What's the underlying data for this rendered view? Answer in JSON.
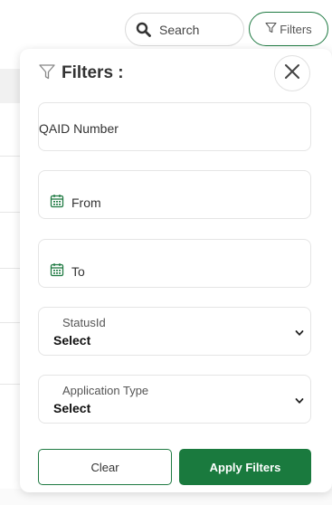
{
  "toolbar": {
    "search_label": "Search",
    "filters_label": "Filters"
  },
  "panel": {
    "title": "Filters :",
    "qaid_placeholder": "QAID Number",
    "from_label": "From",
    "to_label": "To",
    "status": {
      "label": "StatusId",
      "value": "Select"
    },
    "app_type": {
      "label": "Application Type",
      "value": "Select"
    },
    "clear_label": "Clear",
    "apply_label": "Apply Filters"
  },
  "colors": {
    "accent": "#1a7a3e",
    "calendar": "#1f7a42"
  },
  "icons": [
    "search-icon",
    "filter-icon",
    "close-icon",
    "calendar-icon",
    "chevron-down-icon"
  ]
}
